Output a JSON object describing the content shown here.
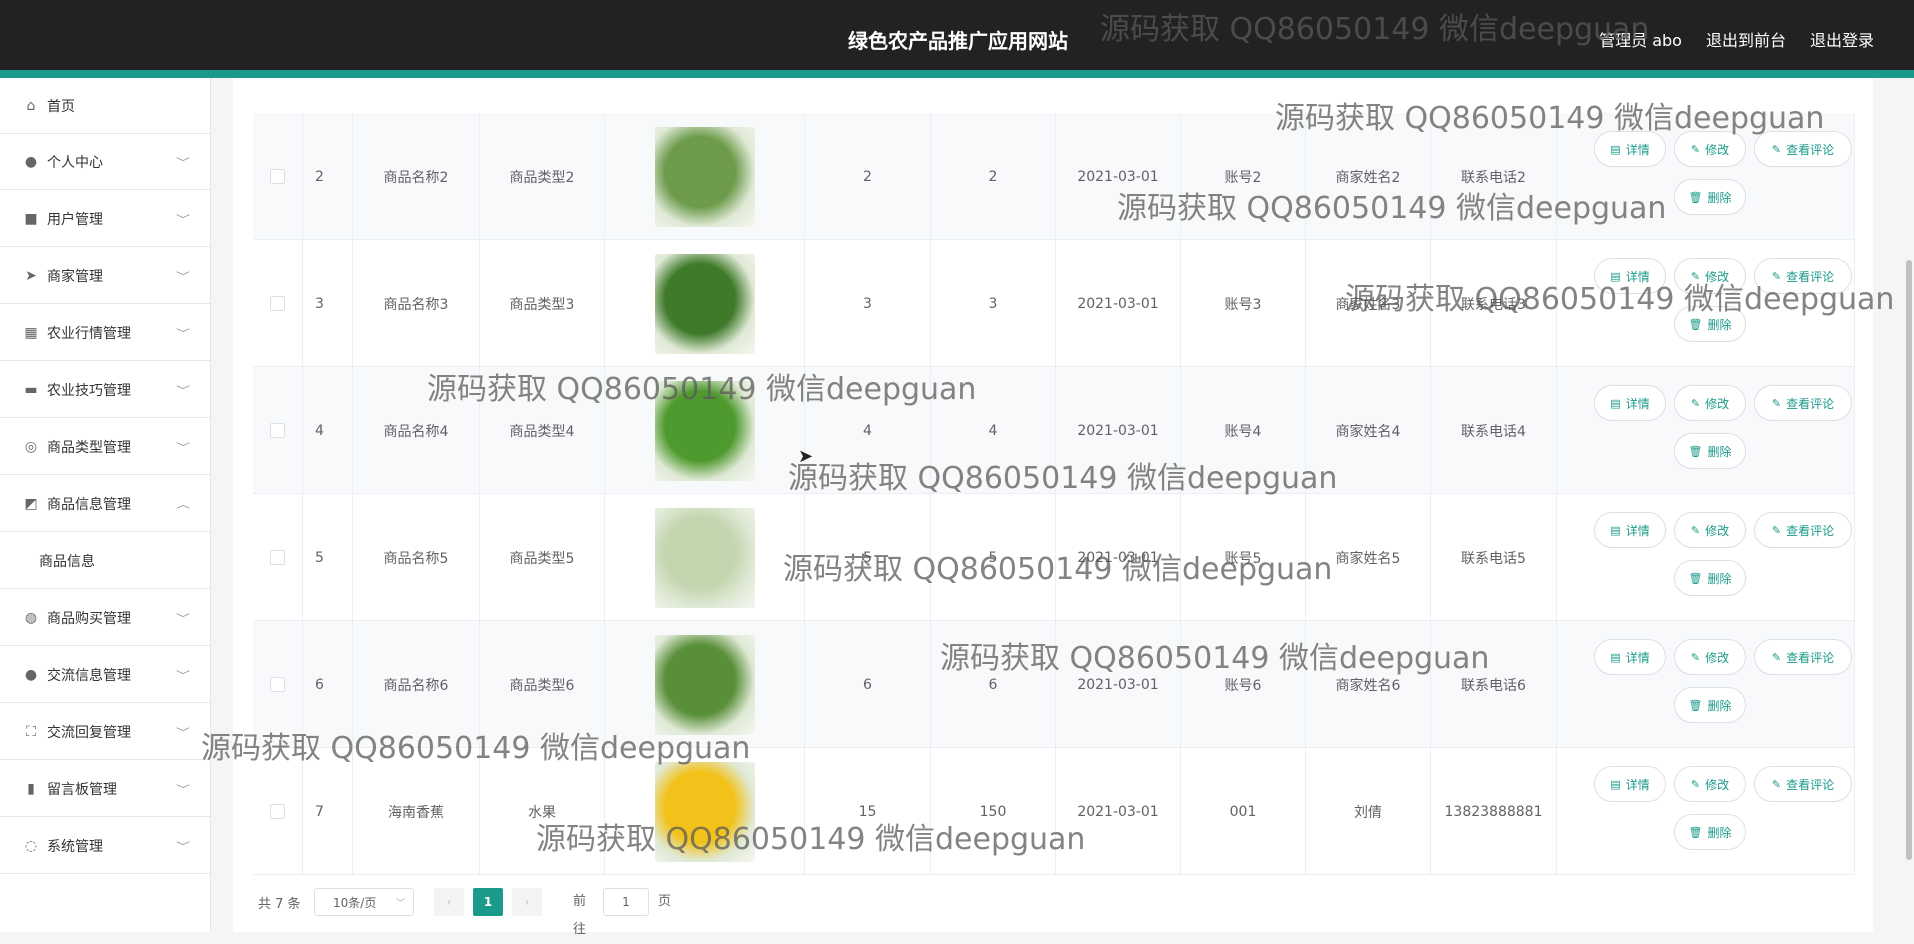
{
  "header": {
    "title": "绿色农产品推广应用网站",
    "links": [
      "管理员 abo",
      "退出到前台",
      "退出登录"
    ]
  },
  "sidebar": {
    "items": [
      {
        "label": "首页",
        "icon": "home-icon",
        "glyph": "⌂"
      },
      {
        "label": "个人中心",
        "icon": "user-icon",
        "glyph": "●"
      },
      {
        "label": "用户管理",
        "icon": "chat-icon",
        "glyph": "■"
      },
      {
        "label": "商家管理",
        "icon": "send-icon",
        "glyph": "➤"
      },
      {
        "label": "农业行情管理",
        "icon": "grid-icon",
        "glyph": "▦"
      },
      {
        "label": "农业技巧管理",
        "icon": "monitor-icon",
        "glyph": "▬"
      },
      {
        "label": "商品类型管理",
        "icon": "compass-icon",
        "glyph": "◎"
      },
      {
        "label": "商品信息管理",
        "icon": "chart-icon",
        "glyph": "◩"
      },
      {
        "label": "商品购买管理",
        "icon": "speed-icon",
        "glyph": "◍"
      },
      {
        "label": "交流信息管理",
        "icon": "person-icon",
        "glyph": "●"
      },
      {
        "label": "交流回复管理",
        "icon": "frame-icon",
        "glyph": "⛶"
      },
      {
        "label": "留言板管理",
        "icon": "bar-chart-icon",
        "glyph": "▮"
      },
      {
        "label": "系统管理",
        "icon": "settings-icon",
        "glyph": "◌"
      }
    ],
    "subitem": "商品信息"
  },
  "table": {
    "rows": [
      {
        "index": "2",
        "name": "商品名称2",
        "type": "商品类型2",
        "v1": "2",
        "v2": "2",
        "date": "2021-03-01",
        "account": "账号2",
        "merchant": "商家姓名2",
        "phone": "联系电话2",
        "color": "#6d9b4b"
      },
      {
        "index": "3",
        "name": "商品名称3",
        "type": "商品类型3",
        "v1": "3",
        "v2": "3",
        "date": "2021-03-01",
        "account": "账号3",
        "merchant": "商家姓名3",
        "phone": "联系电话3",
        "color": "#3f7a2a"
      },
      {
        "index": "4",
        "name": "商品名称4",
        "type": "商品类型4",
        "v1": "4",
        "v2": "4",
        "date": "2021-03-01",
        "account": "账号4",
        "merchant": "商家姓名4",
        "phone": "联系电话4",
        "color": "#4f9a2e"
      },
      {
        "index": "5",
        "name": "商品名称5",
        "type": "商品类型5",
        "v1": "5",
        "v2": "5",
        "date": "2021-03-01",
        "account": "账号5",
        "merchant": "商家姓名5",
        "phone": "联系电话5",
        "color": "#c4d6b0"
      },
      {
        "index": "6",
        "name": "商品名称6",
        "type": "商品类型6",
        "v1": "6",
        "v2": "6",
        "date": "2021-03-01",
        "account": "账号6",
        "merchant": "商家姓名6",
        "phone": "联系电话6",
        "color": "#5a8f3a"
      },
      {
        "index": "7",
        "name": "海南香蕉",
        "type": "水果",
        "v1": "15",
        "v2": "150",
        "date": "2021-03-01",
        "account": "001",
        "merchant": "刘倩",
        "phone": "13823888881",
        "color": "#f2c21b"
      }
    ],
    "buttons": {
      "detail": "详情",
      "edit": "修改",
      "comments": "查看评论",
      "delete": "删除"
    }
  },
  "pagination": {
    "total": "共 7 条",
    "page_size": "10条/页",
    "current": "1",
    "goto_prefix": "前往",
    "goto_value": "1",
    "goto_suffix": "页"
  },
  "watermark": "源码获取 QQ86050149 微信deepguan"
}
